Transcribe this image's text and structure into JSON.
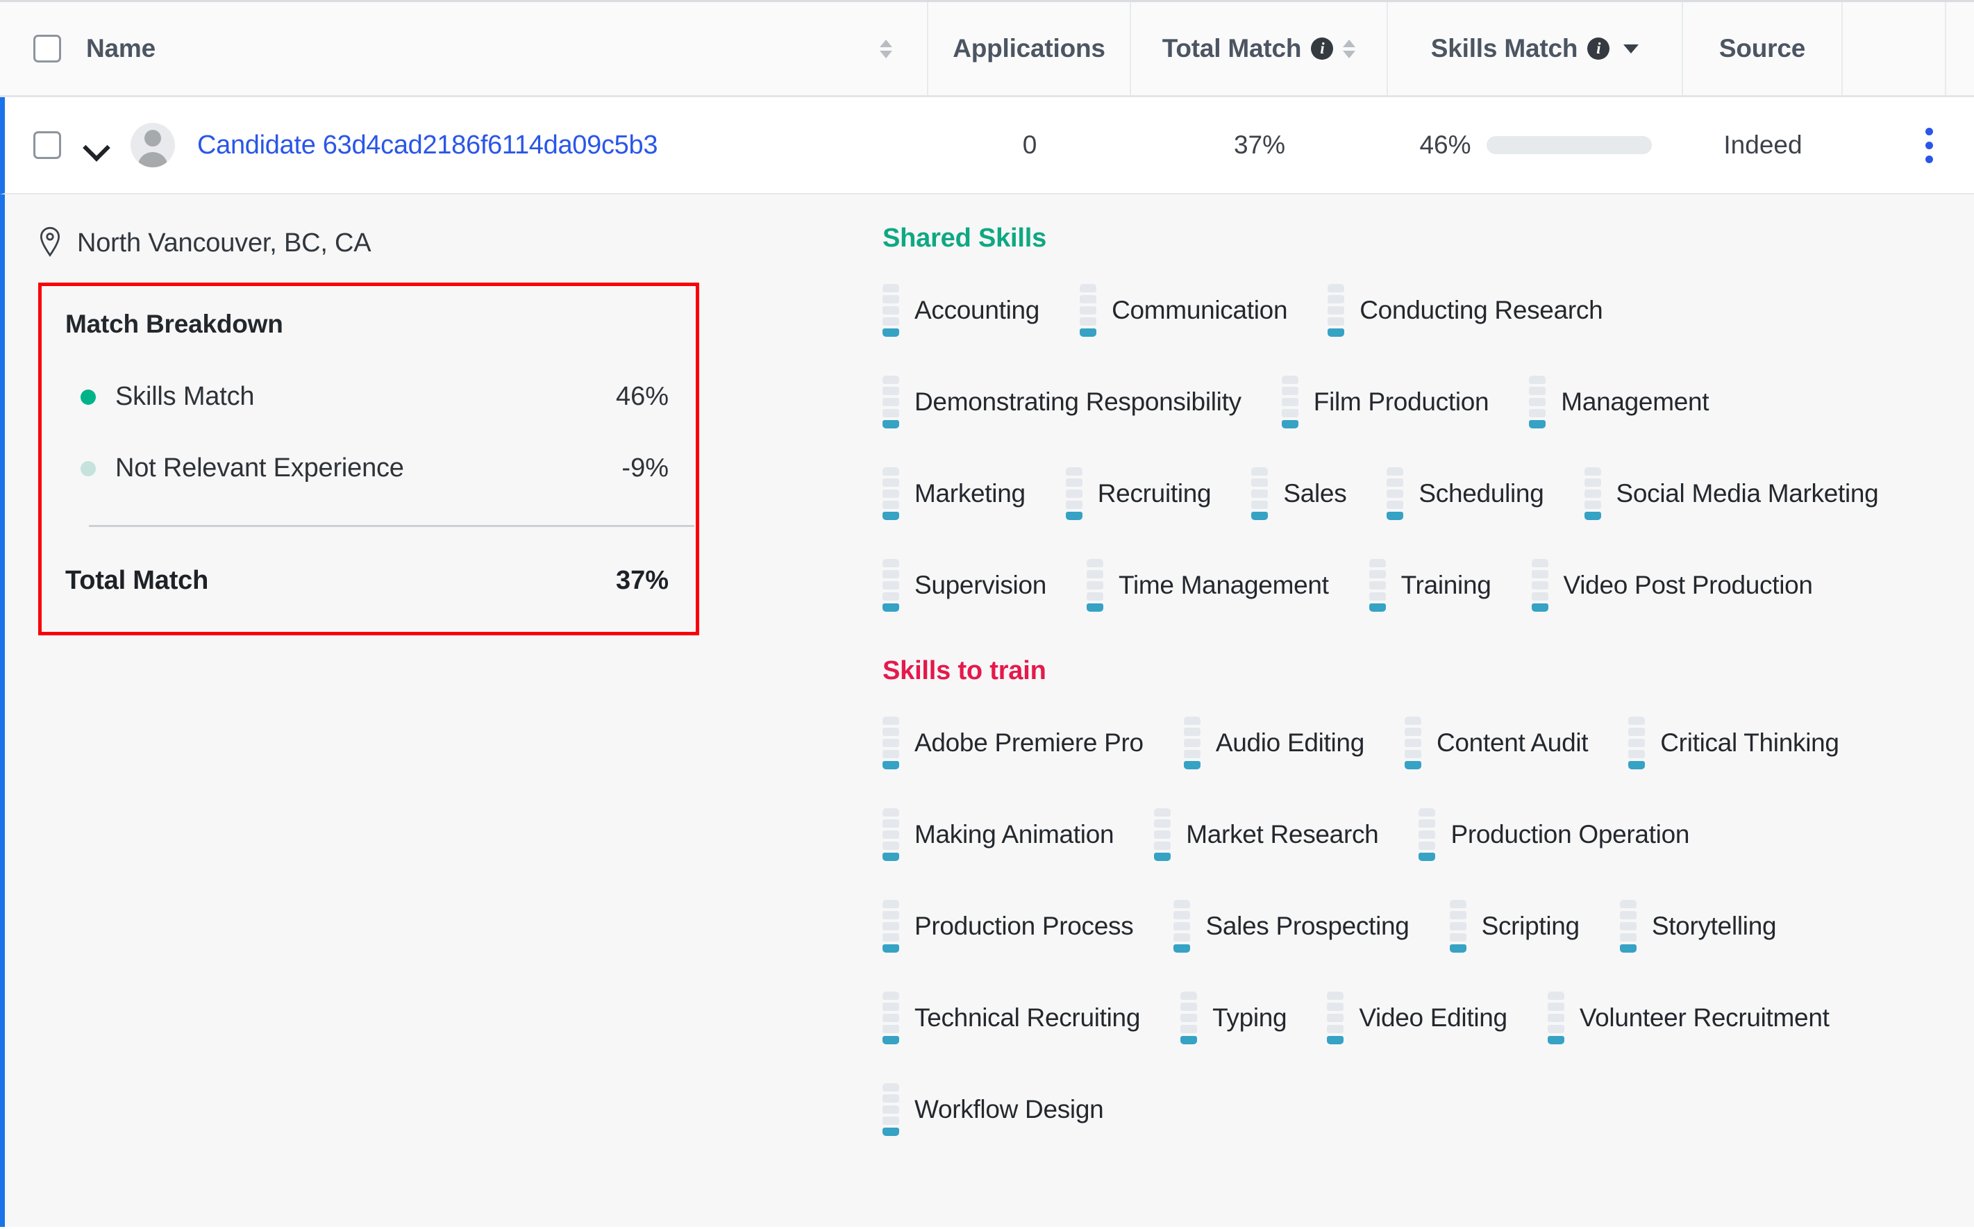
{
  "table_header": {
    "select_all_checkbox": "unchecked",
    "columns": [
      {
        "label": "Name",
        "sortable": true,
        "info": false
      },
      {
        "label": "Applications",
        "sortable": false,
        "info": false
      },
      {
        "label": "Total Match",
        "sortable": true,
        "info": true
      },
      {
        "label": "Skills Match",
        "sortable": false,
        "info": true,
        "dropdown": true
      },
      {
        "label": "Source",
        "sortable": false,
        "info": false
      }
    ]
  },
  "candidate_row": {
    "checkbox": "unchecked",
    "expand_state": "expanded",
    "name": "Candidate 63d4cad2186f6114da09c5b3",
    "applications": "0",
    "total_match": "37%",
    "skills_match": "46%",
    "skills_match_percent": 46,
    "source": "Indeed",
    "more_actions": "kebab-menu"
  },
  "details": {
    "location": "North Vancouver, BC, CA",
    "match_breakdown": {
      "title": "Match Breakdown",
      "rows": [
        {
          "label": "Skills Match",
          "value": "46%",
          "dot_color": "#00b388"
        },
        {
          "label": "Not Relevant Experience",
          "value": "-9%",
          "dot_color": "#c5e3dc"
        }
      ],
      "total_label": "Total Match",
      "total_value": "37%",
      "highlight_color": "#fb0007"
    }
  },
  "skills": {
    "shared": {
      "title": "Shared Skills",
      "color": "#0ea882",
      "items": [
        "Accounting",
        "Communication",
        "Conducting Research",
        "Demonstrating Responsibility",
        "Film Production",
        "Management",
        "Marketing",
        "Recruiting",
        "Sales",
        "Scheduling",
        "Social Media Marketing",
        "Supervision",
        "Time Management",
        "Training",
        "Video Post Production"
      ]
    },
    "to_train": {
      "title": "Skills to train",
      "color": "#e5194b",
      "items": [
        "Adobe Premiere Pro",
        "Audio Editing",
        "Content Audit",
        "Critical Thinking",
        "Making Animation",
        "Market Research",
        "Production Operation",
        "Production Process",
        "Sales Prospecting",
        "Scripting",
        "Storytelling",
        "Technical Recruiting",
        "Typing",
        "Video Editing",
        "Volunteer Recruitment",
        "Workflow Design"
      ]
    },
    "level_bar": {
      "segments": 5,
      "filled": 1,
      "filled_color": "#36a2c4",
      "empty_color": "#e4e8ec"
    }
  }
}
